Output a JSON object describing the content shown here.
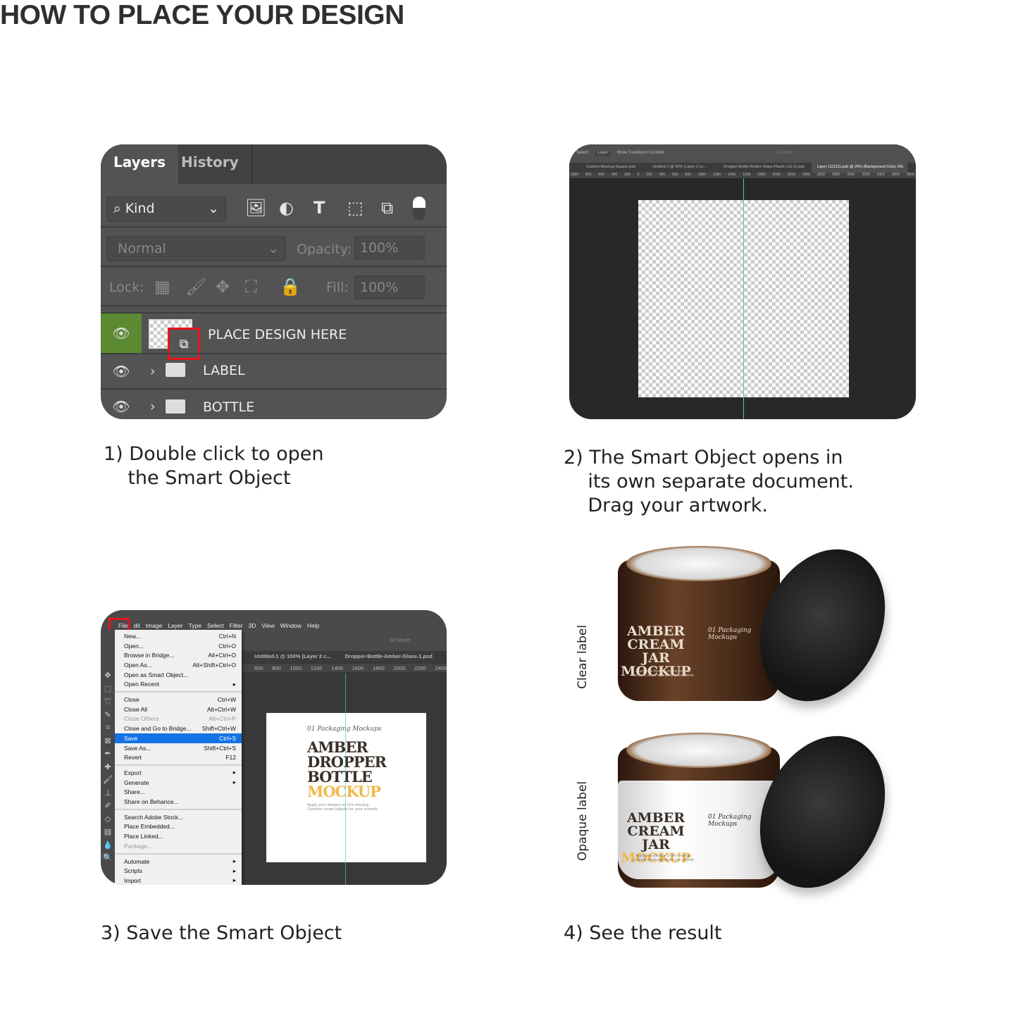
{
  "title": "HOW TO PLACE YOUR DESIGN",
  "steps": [
    {
      "caption": "1) Double click to open\n    the Smart Object"
    },
    {
      "caption": "2) The Smart Object opens in\n    its own separate document.\n    Drag your artwork."
    },
    {
      "caption": "3) Save the Smart Object"
    },
    {
      "caption": "4) See the result"
    }
  ],
  "layers_panel": {
    "tabs": [
      "Layers",
      "History"
    ],
    "filter": "Kind",
    "blend_mode": "Normal",
    "opacity_label": "Opacity:",
    "opacity": "100%",
    "lock_label": "Lock:",
    "fill_label": "Fill:",
    "fill": "100%",
    "layers": [
      {
        "name": "PLACE DESIGN HERE",
        "type": "smart-object",
        "visible": true,
        "selected": true
      },
      {
        "name": "LABEL",
        "type": "group",
        "visible": true
      },
      {
        "name": "BOTTLE",
        "type": "group",
        "visible": true
      }
    ],
    "highlight_color": "#e8141c",
    "eye_active_color": "#5b8a32"
  },
  "smart_doc": {
    "options": {
      "select_label": "Select:",
      "select_value": "Layer",
      "transform": "Show Transform Controls",
      "mode": "3D Mode:"
    },
    "tabs": [
      "Custom-Mockup-Square.psb",
      "Untitled-1 @ 50% (Layer 2 co...",
      "Dropper-Bottle-Amber-Glass-Plastic-Lid-11.psd",
      "Layer 1111111.psb @ 25% (Background Color, RG"
    ],
    "ruler": [
      "1000",
      "800",
      "600",
      "400",
      "200",
      "0",
      "200",
      "400",
      "600",
      "800",
      "1000",
      "1200",
      "1400",
      "1600",
      "1800",
      "2000",
      "2200",
      "2400",
      "2600",
      "2800",
      "3000",
      "3200",
      "3400",
      "3600",
      "3800"
    ]
  },
  "save_step": {
    "menubar": [
      "File",
      "dit",
      "Image",
      "Layer",
      "Type",
      "Select",
      "Filter",
      "3D",
      "View",
      "Window",
      "Help"
    ],
    "menu": [
      [
        {
          "label": "New...",
          "sc": "Ctrl+N"
        },
        {
          "label": "Open...",
          "sc": "Ctrl+O"
        },
        {
          "label": "Browse in Bridge...",
          "sc": "Alt+Ctrl+O"
        },
        {
          "label": "Open As...",
          "sc": "Alt+Shift+Ctrl+O"
        },
        {
          "label": "Open as Smart Object...",
          "sc": ""
        },
        {
          "label": "Open Recent",
          "sc": "▸"
        }
      ],
      [
        {
          "label": "Close",
          "sc": "Ctrl+W"
        },
        {
          "label": "Close All",
          "sc": "Alt+Ctrl+W"
        },
        {
          "label": "Close Others",
          "sc": "Alt+Ctrl+P",
          "disabled": true
        },
        {
          "label": "Close and Go to Bridge...",
          "sc": "Shift+Ctrl+W"
        },
        {
          "label": "Save",
          "sc": "Ctrl+S",
          "selected": true
        },
        {
          "label": "Save As...",
          "sc": "Shift+Ctrl+S"
        },
        {
          "label": "Revert",
          "sc": "F12"
        }
      ],
      [
        {
          "label": "Export",
          "sc": "▸"
        },
        {
          "label": "Generate",
          "sc": "▸"
        },
        {
          "label": "Share...",
          "sc": ""
        },
        {
          "label": "Share on Behance...",
          "sc": ""
        }
      ],
      [
        {
          "label": "Search Adobe Stock...",
          "sc": ""
        },
        {
          "label": "Place Embedded...",
          "sc": ""
        },
        {
          "label": "Place Linked...",
          "sc": ""
        },
        {
          "label": "Package...",
          "sc": "",
          "disabled": true
        }
      ],
      [
        {
          "label": "Automate",
          "sc": "▸"
        },
        {
          "label": "Scripts",
          "sc": "▸"
        },
        {
          "label": "Import",
          "sc": "▸"
        }
      ]
    ],
    "options": {
      "mode": "3D Mode:"
    },
    "tabs": [
      "Untitled-1 @ 100% (Layer 2 c...",
      "Dropper-Bottle-Amber-Glass-1.psd"
    ],
    "ruler": [
      "600",
      "800",
      "1000",
      "1200",
      "1400",
      "1600",
      "1800",
      "2000",
      "2200",
      "2400"
    ],
    "doc": {
      "script": "01 Packaging Mockups",
      "lines": [
        "AMBER",
        "DROPPER",
        "BOTTLE"
      ],
      "accent": "MOCKUP",
      "sub1": "Apply your designs on this mockup.",
      "sub2": "Contains smart objects for your artwork.",
      "accent_color": "#f2b84b"
    }
  },
  "result": {
    "jars": [
      {
        "side_label": "Clear label",
        "title": [
          "AMBER",
          "CREAM JAR"
        ],
        "accent": "MOCKUP",
        "script": "01 Packaging Mockups",
        "note": "Apply your designs on this mockup. Contains smart objects for your artwork."
      },
      {
        "side_label": "Opaque label",
        "title": [
          "AMBER",
          "CREAM JAR"
        ],
        "accent": "MOCKUP",
        "script": "01 Packaging Mockups",
        "note": "Apply your designs on this mockup. Contains smart objects for your artwork."
      }
    ],
    "amber_color": "#4a2c1a",
    "lid_color": "#1c1c1c"
  }
}
